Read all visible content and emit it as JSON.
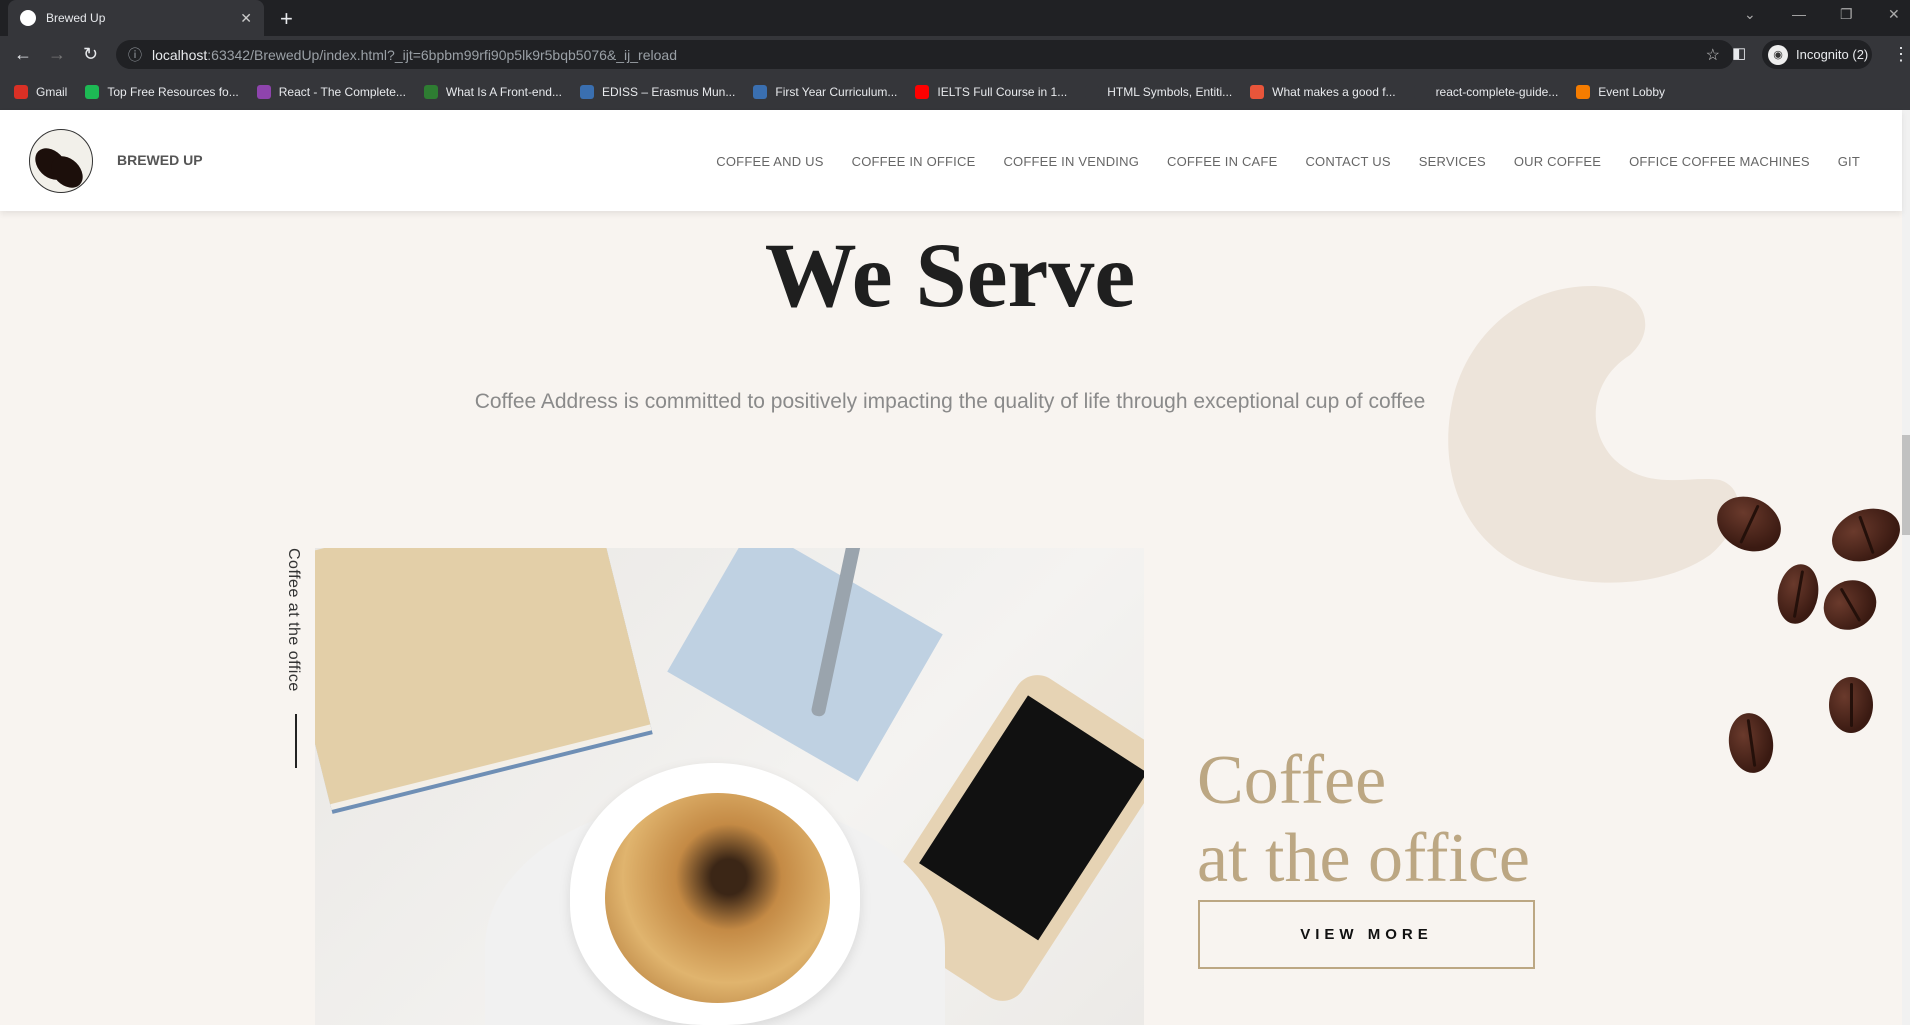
{
  "browser": {
    "tab_title": "Brewed Up",
    "url_host": "localhost",
    "url_rest": ":63342/BrewedUp/index.html?_ijt=6bpbm99rfi90p5lk9r5bqb5076&_ij_reload",
    "profile": "Incognito (2)",
    "bookmarks": [
      {
        "label": "Gmail",
        "color": "#d93025"
      },
      {
        "label": "Top Free Resources fo...",
        "color": "#1db954"
      },
      {
        "label": "React - The Complete...",
        "color": "#8e44ad"
      },
      {
        "label": "What Is A Front-end...",
        "color": "#2e7d32"
      },
      {
        "label": "EDISS – Erasmus Mun...",
        "color": "#3a6fb0"
      },
      {
        "label": "First Year Curriculum...",
        "color": "#3a6fb0"
      },
      {
        "label": "IELTS Full Course in 1...",
        "color": "#ff0000"
      },
      {
        "label": "HTML Symbols, Entiti...",
        "color": "#35363a"
      },
      {
        "label": "What makes a good f...",
        "color": "#e8553a"
      },
      {
        "label": "react-complete-guide...",
        "color": "#35363a"
      },
      {
        "label": "Event Lobby",
        "color": "#f57c00"
      }
    ]
  },
  "site": {
    "brand": "BREWED UP",
    "nav": [
      "COFFEE AND US",
      "COFFEE IN OFFICE",
      "COFFEE IN VENDING",
      "COFFEE IN CAFE",
      "CONTACT US",
      "SERVICES",
      "OUR COFFEE",
      "OFFICE COFFEE MACHINES",
      "GIT"
    ],
    "title": "We Serve",
    "subtitle": "Coffee Address is committed to positively impacting the quality of life through exceptional cup of coffee",
    "side_label": "Coffee at the office",
    "heading_line1": "Coffee",
    "heading_line2": "at the office",
    "button": "VIEW MORE",
    "accent": "#bca783",
    "background": "#f8f4f0"
  }
}
